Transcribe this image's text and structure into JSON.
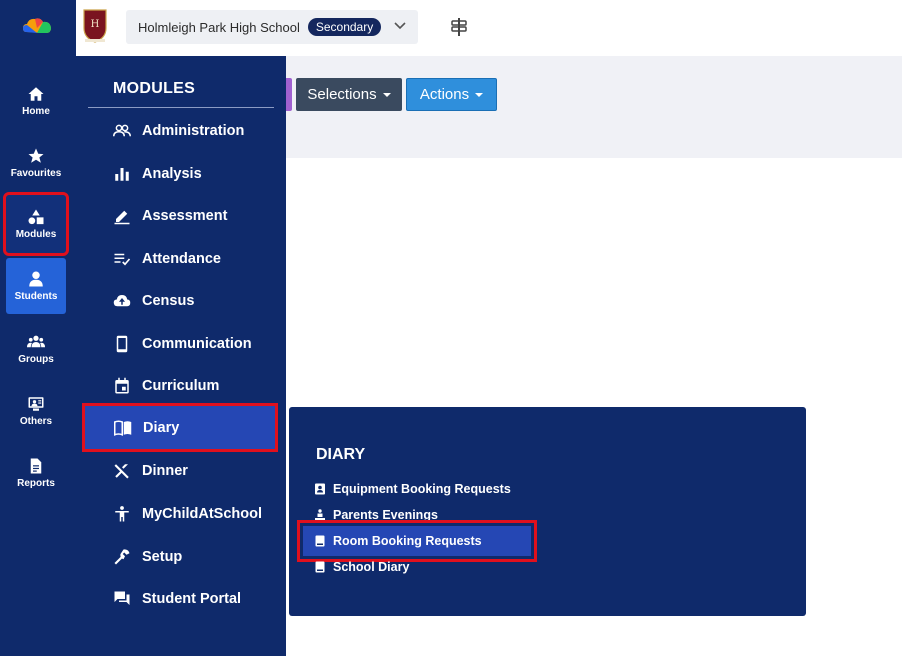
{
  "rail": {
    "items": [
      {
        "label": "Home",
        "icon": "home-icon"
      },
      {
        "label": "Favourites",
        "icon": "star-icon"
      },
      {
        "label": "Modules",
        "icon": "shapes-icon"
      },
      {
        "label": "Students",
        "icon": "person-icon"
      },
      {
        "label": "Groups",
        "icon": "group-icon"
      },
      {
        "label": "Others",
        "icon": "others-icon"
      },
      {
        "label": "Reports",
        "icon": "document-icon"
      }
    ]
  },
  "topbar": {
    "school_name": "Holmleigh Park High School",
    "school_type": "Secondary"
  },
  "toolbar": {
    "selections_label": "Selections",
    "actions_label": "Actions"
  },
  "modules": {
    "title": "MODULES",
    "items": [
      {
        "label": "Administration",
        "icon": "people-icon"
      },
      {
        "label": "Analysis",
        "icon": "bar-chart-icon"
      },
      {
        "label": "Assessment",
        "icon": "pen-icon"
      },
      {
        "label": "Attendance",
        "icon": "list-check-icon"
      },
      {
        "label": "Census",
        "icon": "cloud-upload-icon"
      },
      {
        "label": "Communication",
        "icon": "phone-icon"
      },
      {
        "label": "Curriculum",
        "icon": "calendar-icon"
      },
      {
        "label": "Diary",
        "icon": "book-open-icon"
      },
      {
        "label": "Dinner",
        "icon": "cutlery-icon"
      },
      {
        "label": "MyChildAtSchool",
        "icon": "child-icon"
      },
      {
        "label": "Setup",
        "icon": "wrench-icon"
      },
      {
        "label": "Student Portal",
        "icon": "chat-icon"
      }
    ]
  },
  "diary": {
    "title": "DIARY",
    "items": [
      {
        "label": "Equipment Booking Requests",
        "icon": "contact-book-icon"
      },
      {
        "label": "Parents Evenings",
        "icon": "presenter-icon"
      },
      {
        "label": "Room Booking Requests",
        "icon": "book-icon"
      },
      {
        "label": "School Diary",
        "icon": "book-icon"
      }
    ]
  },
  "colors": {
    "navy": "#0f2a6b",
    "active_blue": "#2563d8",
    "highlight_red": "#e0101d"
  }
}
